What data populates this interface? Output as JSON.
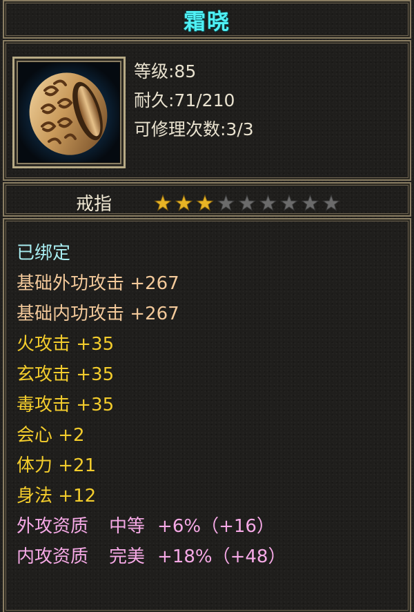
{
  "item": {
    "name": "霜晓",
    "icon": "ring-icon",
    "level_line": "等级:85",
    "durability_line": "耐久:71/210",
    "repair_line": "可修理次数:3/3",
    "type": "戒指",
    "stars": {
      "filled": 3,
      "total": 9
    }
  },
  "attributes": [
    {
      "text": "已绑定",
      "color": "#a9eef2"
    },
    {
      "text": "基础外功攻击  +267",
      "color": "#f3c99a"
    },
    {
      "text": "基础内功攻击  +267",
      "color": "#f3c99a"
    },
    {
      "text": "火攻击  +35",
      "color": "#f4cd2c"
    },
    {
      "text": "玄攻击  +35",
      "color": "#f4cd2c"
    },
    {
      "text": "毒攻击  +35",
      "color": "#f4cd2c"
    },
    {
      "text": "会心  +2",
      "color": "#f4cd2c"
    },
    {
      "text": "体力  +21",
      "color": "#f4cd2c"
    },
    {
      "text": "身法  +12",
      "color": "#f4cd2c"
    }
  ],
  "qualities": [
    {
      "label": "外攻资质",
      "grade": "中等",
      "value": "+6%（+16）",
      "color": "#f6a9e6"
    },
    {
      "label": "内攻资质",
      "grade": "完美",
      "value": "+18%（+48）",
      "color": "#f6a9e6"
    }
  ],
  "colors": {
    "title": "#4ff0f4",
    "star_filled": "#e8b425",
    "star_empty": "#6b6b6b"
  }
}
